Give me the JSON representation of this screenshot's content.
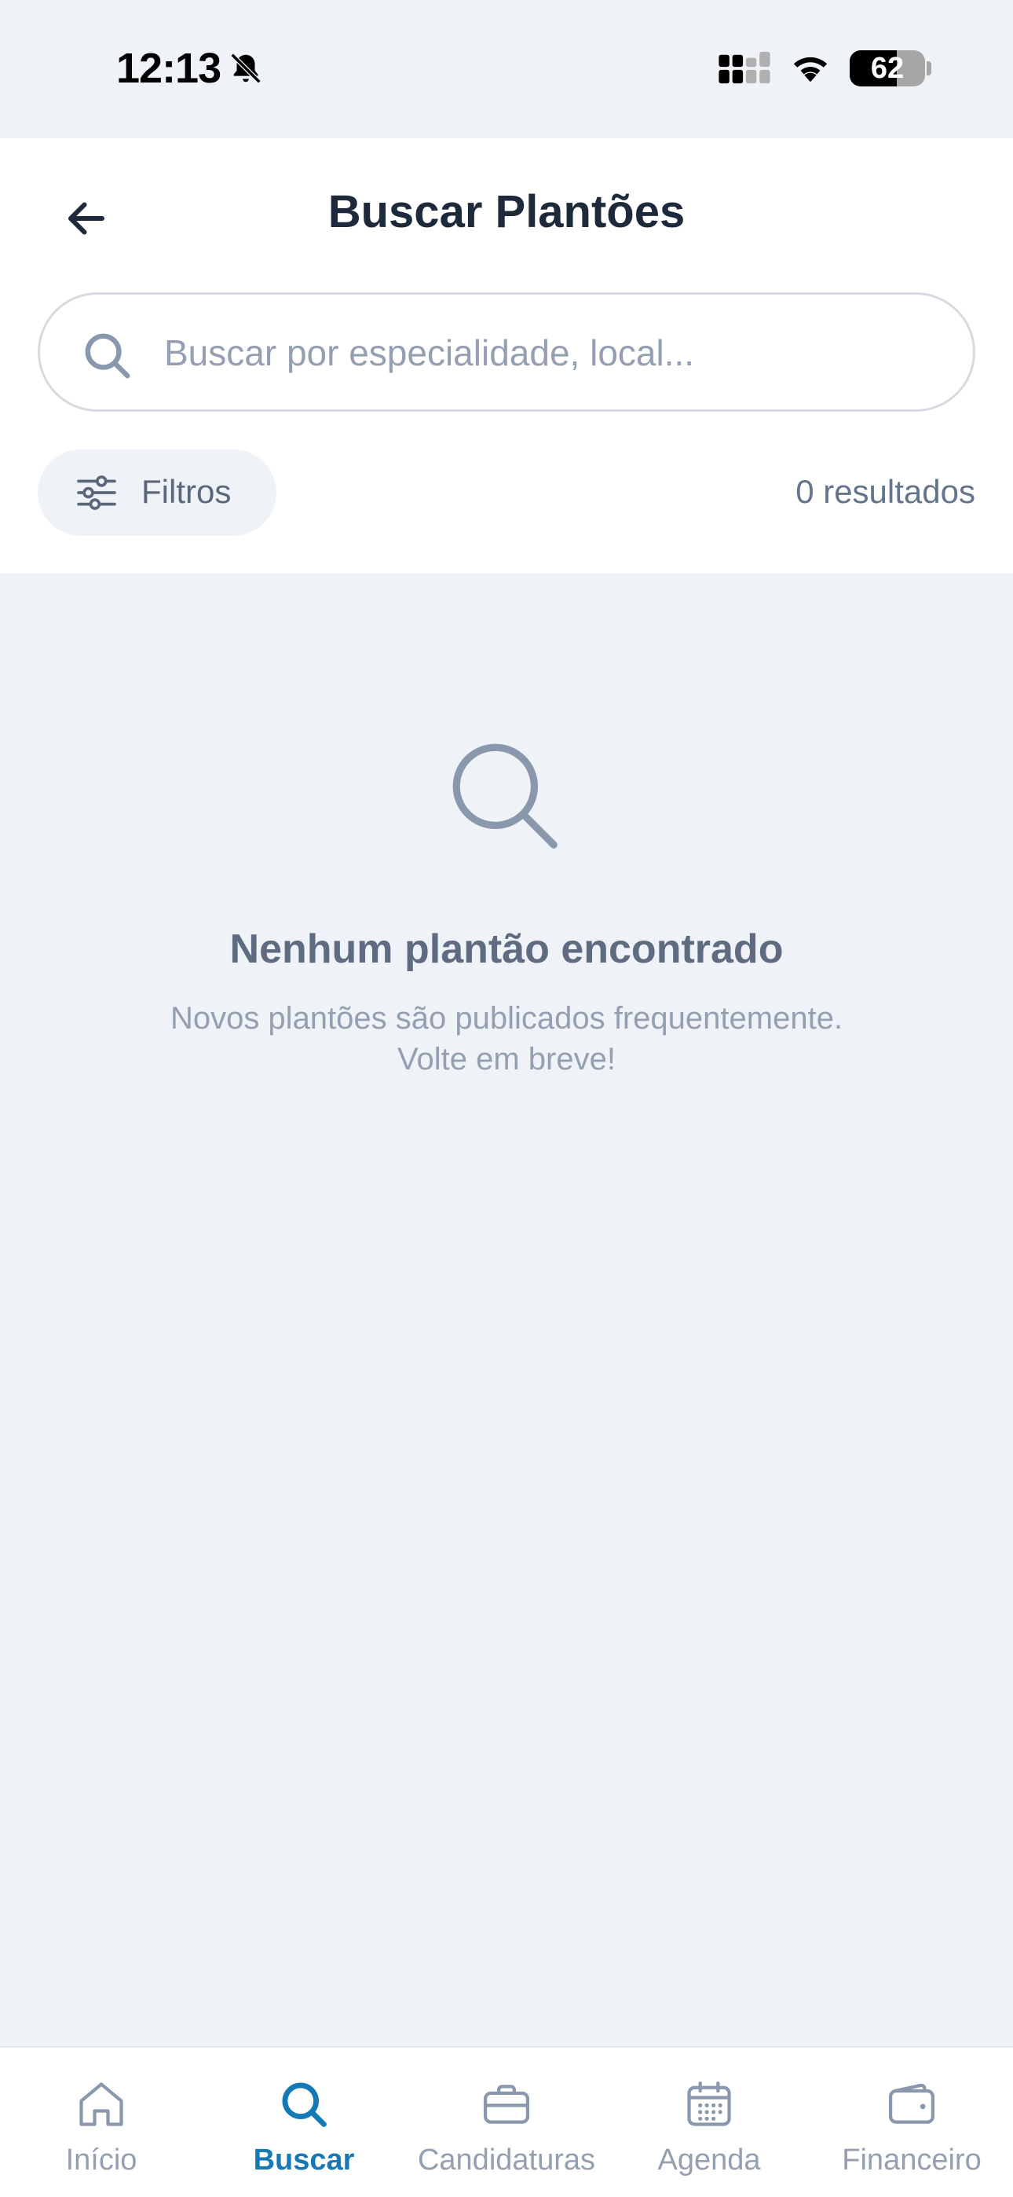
{
  "status_bar": {
    "time": "12:13",
    "battery": "62",
    "battery_level": 0.62
  },
  "header": {
    "title": "Buscar Plantões",
    "back_icon": "arrow-left-icon"
  },
  "search": {
    "placeholder": "Buscar por especialidade, local...",
    "value": ""
  },
  "filters": {
    "label": "Filtros",
    "icon": "sliders-icon"
  },
  "results": {
    "count_label": "0 resultados"
  },
  "empty_state": {
    "icon": "search-icon",
    "title": "Nenhum plantão encontrado",
    "subtitle_line1": "Novos plantões são publicados frequentemente.",
    "subtitle_line2": "Volte em breve!"
  },
  "bottom_nav": {
    "active": "Buscar",
    "items": [
      {
        "label": "Início",
        "icon": "home-icon"
      },
      {
        "label": "Buscar",
        "icon": "search-icon"
      },
      {
        "label": "Candidaturas",
        "icon": "briefcase-icon"
      },
      {
        "label": "Agenda",
        "icon": "calendar-icon"
      },
      {
        "label": "Financeiro",
        "icon": "wallet-icon"
      }
    ]
  },
  "colors": {
    "accent": "#1579b5",
    "background": "#eff2f7",
    "muted": "#94a0b2",
    "title": "#1e2a3b"
  }
}
